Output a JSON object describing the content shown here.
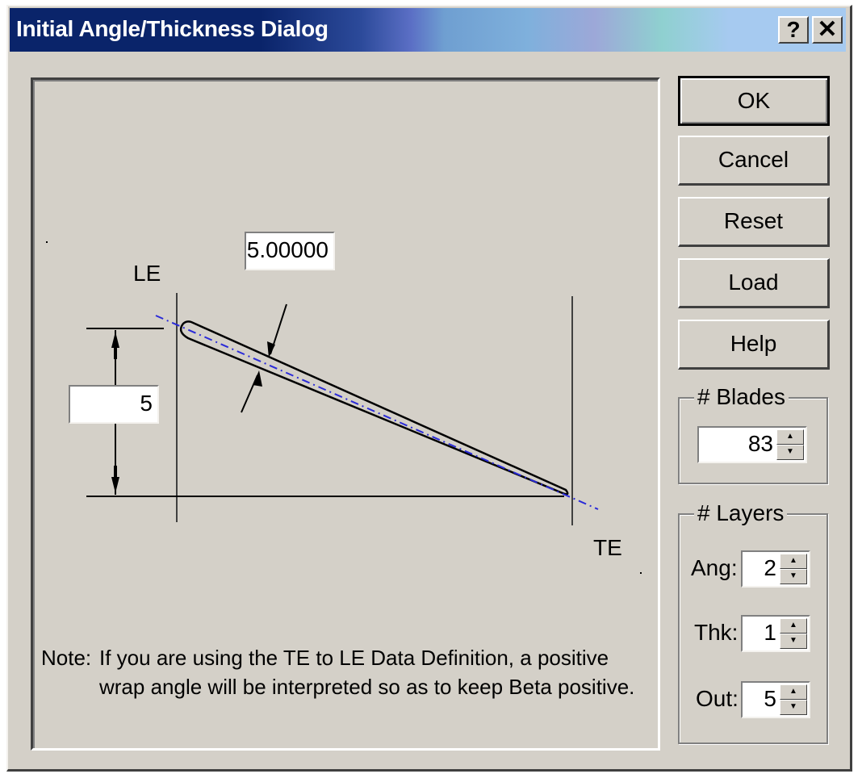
{
  "window": {
    "title": "Initial Angle/Thickness Dialog",
    "help_glyph": "?",
    "close_glyph": "✕"
  },
  "diagram": {
    "le_label": "LE",
    "te_label": "TE",
    "thickness_value": "5.00000",
    "height_value": "5"
  },
  "note": {
    "prefix": "Note:",
    "text": "If you are using the TE to LE Data Definition, a positive wrap angle will be interpreted so as to keep Beta positive."
  },
  "buttons": {
    "ok": "OK",
    "cancel": "Cancel",
    "reset": "Reset",
    "load": "Load",
    "help": "Help"
  },
  "blades": {
    "title": "# Blades",
    "value": "83"
  },
  "layers": {
    "title": "# Layers",
    "ang_label": "Ang:",
    "ang_value": "2",
    "thk_label": "Thk:",
    "thk_value": "1",
    "out_label": "Out:",
    "out_value": "5"
  },
  "colors": {
    "title_dark": "#0a246a",
    "face": "#d4d0c8",
    "centerline": "#2a2ad8"
  },
  "icons": {
    "help": "question-mark-icon",
    "close": "close-icon",
    "spin_up": "spin-up-arrow-icon",
    "spin_down": "spin-down-arrow-icon"
  }
}
